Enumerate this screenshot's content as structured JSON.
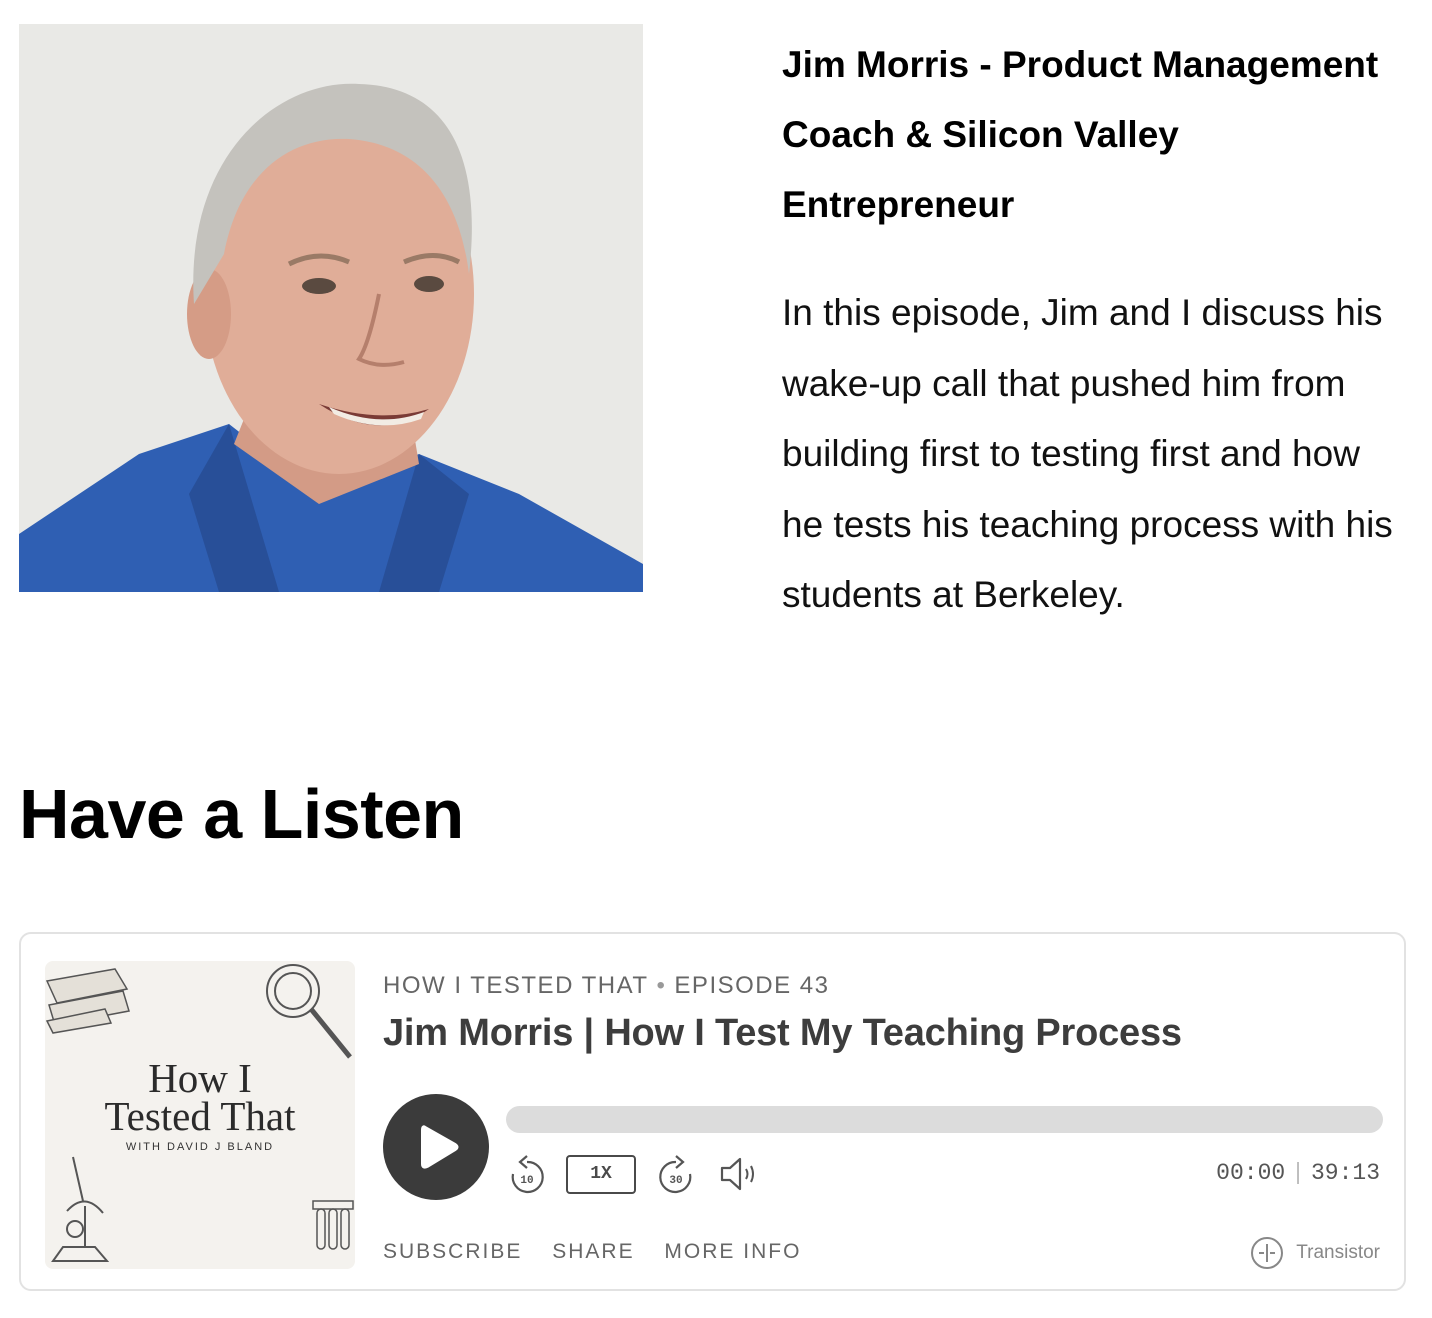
{
  "guest": {
    "title": "Jim Morris - Product Management Coach & Silicon Valley Entrepreneur",
    "description": "In this episode, Jim and I discuss his wake-up call that pushed him from building first to testing first and how he tests his teaching process with his students at Berkeley."
  },
  "section": {
    "heading": "Have a Listen"
  },
  "player": {
    "show_name": "HOW I TESTED THAT",
    "episode": "EPISODE 43",
    "episode_title": "Jim Morris | How I Test My Teaching Process",
    "cover": {
      "title_line1": "How I",
      "title_line2": "Tested That",
      "subtitle": "WITH DAVID J BLAND"
    },
    "rewind_seconds": "10",
    "forward_seconds": "30",
    "speed": "1X",
    "current_time": "00:00",
    "duration": "39:13",
    "progress": 0,
    "links": {
      "subscribe": "SUBSCRIBE",
      "share": "SHARE",
      "more_info": "MORE INFO"
    },
    "brand": "Transistor",
    "colors": {
      "button": "#3b3b3b",
      "track": "#dcdcdc",
      "border": "#e2e2e2"
    }
  }
}
